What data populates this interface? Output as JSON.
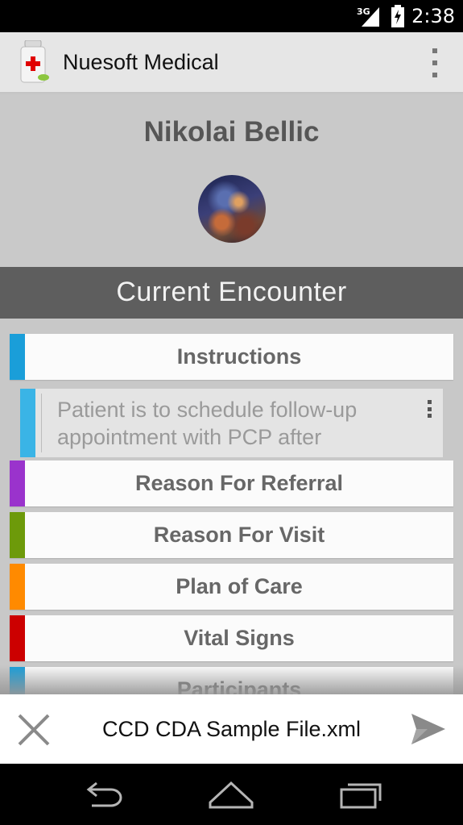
{
  "status_bar": {
    "network": "3G",
    "time": "2:38"
  },
  "action_bar": {
    "app_title": "Nuesoft Medical",
    "overflow_icon": "overflow-menu-icon"
  },
  "patient": {
    "name": "Nikolai Bellic"
  },
  "section": {
    "title": "Current Encounter"
  },
  "list": {
    "items": [
      {
        "label": "Instructions",
        "color": "#1a9ed9"
      },
      {
        "label": "Reason For Referral",
        "color": "#9a33cc"
      },
      {
        "label": "Reason For Visit",
        "color": "#6d9a0a"
      },
      {
        "label": "Plan of Care",
        "color": "#ff8a00"
      },
      {
        "label": "Vital Signs",
        "color": "#cc0000"
      },
      {
        "label": "Participants",
        "color": "#1a9ed9"
      }
    ],
    "instructions_detail": {
      "text": "Patient is to schedule follow-up appointment with PCP after",
      "color": "#3ab4e6"
    }
  },
  "file_bar": {
    "file_name": "CCD CDA Sample File.xml",
    "close_icon": "close-icon",
    "send_icon": "send-icon"
  },
  "nav_bar": {
    "back_icon": "back-icon",
    "home_icon": "home-icon",
    "recents_icon": "recents-icon"
  }
}
